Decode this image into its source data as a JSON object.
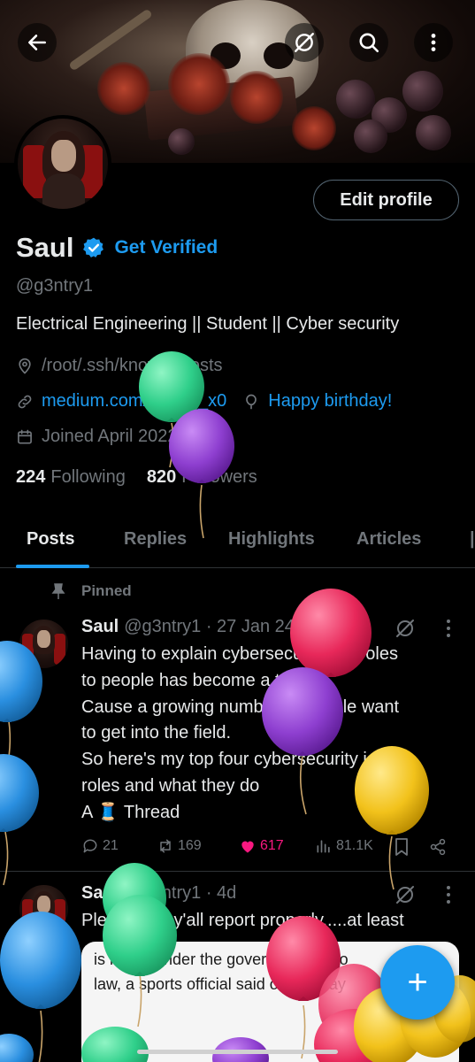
{
  "header": {
    "back_icon": "arrow-left-icon",
    "grok_icon": "grok-icon",
    "search_icon": "search-icon",
    "more_icon": "more-vertical-icon"
  },
  "profile": {
    "edit_profile_label": "Edit profile",
    "name": "Saul",
    "get_verified_label": "Get Verified",
    "handle": "@g3ntry1",
    "bio": "Electrical Engineering || Student || Cyber security",
    "location": "/root/.ssh/known_hosts",
    "website": "medium.com/@saul_x0",
    "birthday": "Happy birthday!",
    "joined": "Joined April 2022",
    "following_count": "224",
    "following_label": "Following",
    "followers_count": "820",
    "followers_label": "Followers"
  },
  "tabs": [
    {
      "label": "Posts",
      "active": true
    },
    {
      "label": "Replies",
      "active": false
    },
    {
      "label": "Highlights",
      "active": false
    },
    {
      "label": "Articles",
      "active": false
    }
  ],
  "pinned_label": "Pinned",
  "tweets": [
    {
      "name": "Saul",
      "meta": "@g3ntry1 · 27 Jan 24",
      "lines": [
        "Having to explain cybersecurity job roles",
        "to people has become a task",
        "Cause a growing number of people want",
        "to get into the field.",
        "So here's my top four cybersecurity job",
        "roles and what they do",
        "A 🧵 Thread"
      ],
      "replies": "21",
      "retweets": "169",
      "likes": "617",
      "views": "81.1K"
    },
    {
      "name": "Saul",
      "meta": "@g3ntry1 · 4d",
      "lines": [
        "Please can y'all report properly.....at least"
      ],
      "media_lines": [
        "is illegal under the government's mo",
        "law, a sports official said on Sunday"
      ]
    }
  ],
  "fab_label": "+",
  "colors": {
    "accent": "#1d9bf0",
    "like": "#f91880",
    "background": "#000000",
    "muted": "#71767b",
    "balloon_green": "#3ddc97",
    "balloon_purple": "#8e3fd0",
    "balloon_red": "#e8285a",
    "balloon_blue": "#2a8fe0",
    "balloon_yellow": "#f2c21b"
  }
}
